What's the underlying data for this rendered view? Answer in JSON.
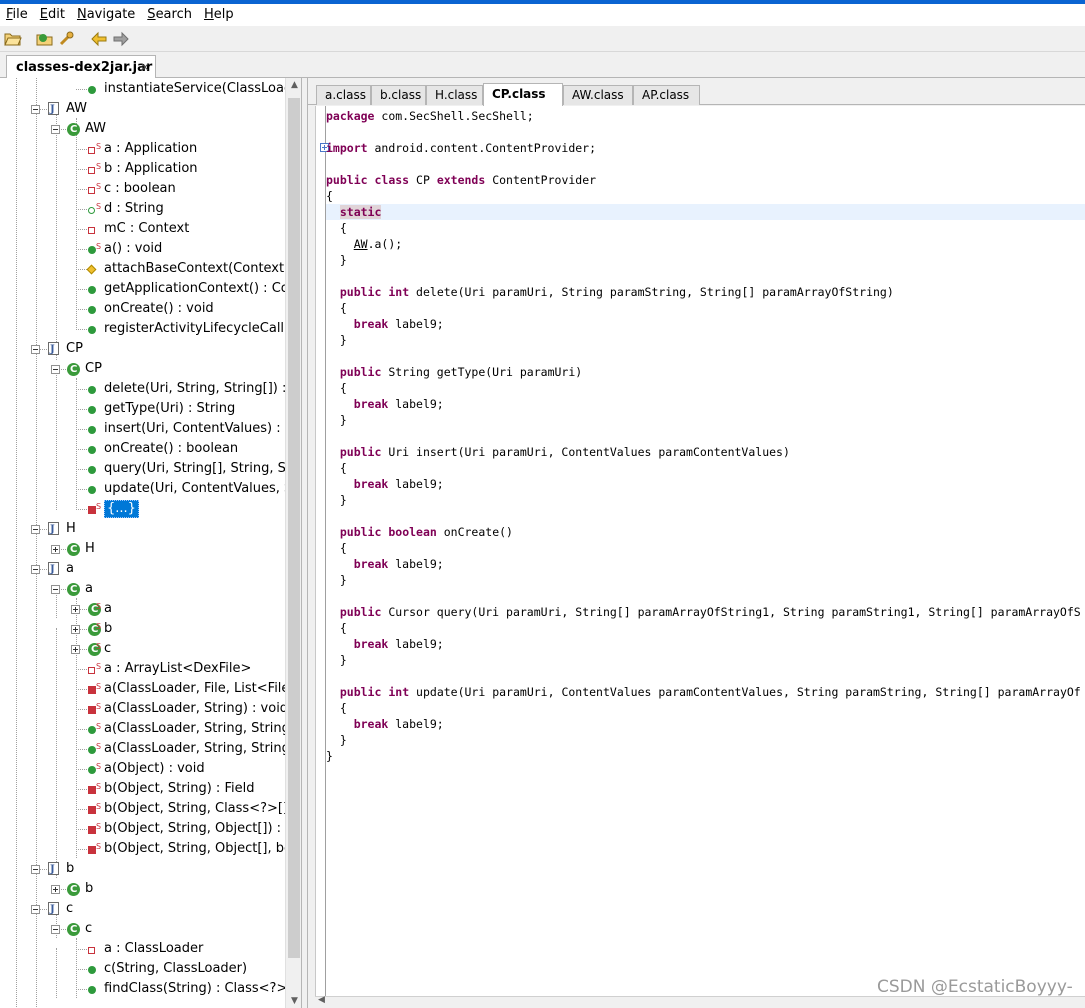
{
  "menu": [
    {
      "label": "File",
      "mnemonic": "F",
      "rest": "ile"
    },
    {
      "label": "Edit",
      "mnemonic": "E",
      "rest": "dit"
    },
    {
      "label": "Navigate",
      "mnemonic": "N",
      "rest": "avigate"
    },
    {
      "label": "Search",
      "mnemonic": "S",
      "rest": "earch"
    },
    {
      "label": "Help",
      "mnemonic": "H",
      "rest": "elp"
    }
  ],
  "toolbar": {
    "icons": [
      "open-file-icon",
      "open-type-icon",
      "search-icon",
      "back-arrow-icon",
      "forward-arrow-icon"
    ]
  },
  "file_tab": {
    "label": "classes-dex2jar.jar",
    "close": "×"
  },
  "tree": [
    {
      "type": "method",
      "label": "instantiateService(ClassLoader,",
      "level": 3
    },
    {
      "type": "file",
      "label": "AW",
      "level": 1,
      "expander": "minus"
    },
    {
      "type": "class",
      "label": "AW",
      "level": 2,
      "expander": "minus"
    },
    {
      "type": "field-red-s",
      "label": "a : Application",
      "level": 3
    },
    {
      "type": "field-red-s",
      "label": "b : Application",
      "level": 3
    },
    {
      "type": "field-red-s",
      "label": "c : boolean",
      "level": 3
    },
    {
      "type": "field-green-s",
      "label": "d : String",
      "level": 3
    },
    {
      "type": "field-red",
      "label": "mC : Context",
      "level": 3
    },
    {
      "type": "method-s",
      "label": "a() : void",
      "level": 3
    },
    {
      "type": "diamond",
      "label": "attachBaseContext(Context) : vo",
      "level": 3
    },
    {
      "type": "method",
      "label": "getApplicationContext() : Conte",
      "level": 3
    },
    {
      "type": "method",
      "label": "onCreate() : void",
      "level": 3
    },
    {
      "type": "method",
      "label": "registerActivityLifecycleCallback",
      "level": 3
    },
    {
      "type": "file",
      "label": "CP",
      "level": 1,
      "expander": "minus"
    },
    {
      "type": "class",
      "label": "CP",
      "level": 2,
      "expander": "minus"
    },
    {
      "type": "method",
      "label": "delete(Uri, String, String[]) : int",
      "level": 3
    },
    {
      "type": "method",
      "label": "getType(Uri) : String",
      "level": 3
    },
    {
      "type": "method",
      "label": "insert(Uri, ContentValues) : Uri",
      "level": 3
    },
    {
      "type": "method",
      "label": "onCreate() : boolean",
      "level": 3
    },
    {
      "type": "method",
      "label": "query(Uri, String[], String, String",
      "level": 3
    },
    {
      "type": "method",
      "label": "update(Uri, ContentValues, Stri",
      "level": 3
    },
    {
      "type": "method-red-s",
      "label": "{...}",
      "level": 3,
      "selected": true
    },
    {
      "type": "file",
      "label": "H",
      "level": 1,
      "expander": "minus"
    },
    {
      "type": "class",
      "label": "H",
      "level": 2,
      "expander": "plus"
    },
    {
      "type": "file",
      "label": "a",
      "level": 1,
      "expander": "minus"
    },
    {
      "type": "class",
      "label": "a",
      "level": 2,
      "expander": "minus"
    },
    {
      "type": "class-s",
      "label": "a",
      "level": 3,
      "expander": "plus"
    },
    {
      "type": "class-s",
      "label": "b",
      "level": 3,
      "expander": "plus"
    },
    {
      "type": "class-s",
      "label": "c",
      "level": 3,
      "expander": "plus"
    },
    {
      "type": "field-red-s",
      "label": "a : ArrayList<DexFile>",
      "level": 3
    },
    {
      "type": "method-red-s",
      "label": "a(ClassLoader, File, List<File>,",
      "level": 3
    },
    {
      "type": "method-red-s",
      "label": "a(ClassLoader, String) : void",
      "level": 3
    },
    {
      "type": "method-s",
      "label": "a(ClassLoader, String, String) :",
      "level": 3
    },
    {
      "type": "method-s",
      "label": "a(ClassLoader, String, String, b",
      "level": 3
    },
    {
      "type": "method-s",
      "label": "a(Object) : void",
      "level": 3
    },
    {
      "type": "method-red-s",
      "label": "b(Object, String) : Field",
      "level": 3
    },
    {
      "type": "method-red-s",
      "label": "b(Object, String, Class<?>[]) : M",
      "level": 3
    },
    {
      "type": "method-red-s",
      "label": "b(Object, String, Object[]) : voi",
      "level": 3
    },
    {
      "type": "method-red-s",
      "label": "b(Object, String, Object[], bool",
      "level": 3
    },
    {
      "type": "file",
      "label": "b",
      "level": 1,
      "expander": "minus"
    },
    {
      "type": "class",
      "label": "b",
      "level": 2,
      "expander": "plus"
    },
    {
      "type": "file",
      "label": "c",
      "level": 1,
      "expander": "minus"
    },
    {
      "type": "class",
      "label": "c",
      "level": 2,
      "expander": "minus"
    },
    {
      "type": "field-red",
      "label": "a : ClassLoader",
      "level": 3
    },
    {
      "type": "method",
      "label": "c(String, ClassLoader)",
      "level": 3
    },
    {
      "type": "method",
      "label": "findClass(String) : Class<?>",
      "level": 3
    }
  ],
  "code_tabs": [
    {
      "label": "a.class"
    },
    {
      "label": "b.class"
    },
    {
      "label": "H.class"
    },
    {
      "label": "CP.class",
      "active": true
    },
    {
      "label": "AW.class"
    },
    {
      "label": "AP.class"
    }
  ],
  "code_lines": [
    [
      {
        "t": "package",
        "c": "kw"
      },
      {
        "t": " com.SecShell.SecShell;"
      }
    ],
    [],
    [
      {
        "t": "import",
        "c": "kw"
      },
      {
        "t": " android.content.ContentProvider;"
      }
    ],
    [],
    [
      {
        "t": "public",
        "c": "kw"
      },
      {
        "t": " "
      },
      {
        "t": "class",
        "c": "kw"
      },
      {
        "t": " CP "
      },
      {
        "t": "extends",
        "c": "kw"
      },
      {
        "t": " ContentProvider"
      }
    ],
    [
      {
        "t": "{"
      }
    ],
    [
      {
        "t": "  "
      },
      {
        "t": "static",
        "c": "kw-hl"
      }
    ],
    [
      {
        "t": "  {"
      }
    ],
    [
      {
        "t": "    "
      },
      {
        "t": "AW",
        "c": "u"
      },
      {
        "t": ".a();"
      }
    ],
    [
      {
        "t": "  }"
      }
    ],
    [],
    [
      {
        "t": "  "
      },
      {
        "t": "public",
        "c": "kw"
      },
      {
        "t": " "
      },
      {
        "t": "int",
        "c": "kw"
      },
      {
        "t": " delete(Uri paramUri, String paramString, String[] paramArrayOfString)"
      }
    ],
    [
      {
        "t": "  {"
      }
    ],
    [
      {
        "t": "    "
      },
      {
        "t": "break",
        "c": "kw"
      },
      {
        "t": " label9;"
      }
    ],
    [
      {
        "t": "  }"
      }
    ],
    [],
    [
      {
        "t": "  "
      },
      {
        "t": "public",
        "c": "kw"
      },
      {
        "t": " String getType(Uri paramUri)"
      }
    ],
    [
      {
        "t": "  {"
      }
    ],
    [
      {
        "t": "    "
      },
      {
        "t": "break",
        "c": "kw"
      },
      {
        "t": " label9;"
      }
    ],
    [
      {
        "t": "  }"
      }
    ],
    [],
    [
      {
        "t": "  "
      },
      {
        "t": "public",
        "c": "kw"
      },
      {
        "t": " Uri insert(Uri paramUri, ContentValues paramContentValues)"
      }
    ],
    [
      {
        "t": "  {"
      }
    ],
    [
      {
        "t": "    "
      },
      {
        "t": "break",
        "c": "kw"
      },
      {
        "t": " label9;"
      }
    ],
    [
      {
        "t": "  }"
      }
    ],
    [],
    [
      {
        "t": "  "
      },
      {
        "t": "public",
        "c": "kw"
      },
      {
        "t": " "
      },
      {
        "t": "boolean",
        "c": "kw"
      },
      {
        "t": " onCreate()"
      }
    ],
    [
      {
        "t": "  {"
      }
    ],
    [
      {
        "t": "    "
      },
      {
        "t": "break",
        "c": "kw"
      },
      {
        "t": " label9;"
      }
    ],
    [
      {
        "t": "  }"
      }
    ],
    [],
    [
      {
        "t": "  "
      },
      {
        "t": "public",
        "c": "kw"
      },
      {
        "t": " Cursor query(Uri paramUri, String[] paramArrayOfString1, String paramString1, String[] paramArrayOfS"
      }
    ],
    [
      {
        "t": "  {"
      }
    ],
    [
      {
        "t": "    "
      },
      {
        "t": "break",
        "c": "kw"
      },
      {
        "t": " label9;"
      }
    ],
    [
      {
        "t": "  }"
      }
    ],
    [],
    [
      {
        "t": "  "
      },
      {
        "t": "public",
        "c": "kw"
      },
      {
        "t": " "
      },
      {
        "t": "int",
        "c": "kw"
      },
      {
        "t": " update(Uri paramUri, ContentValues paramContentValues, String paramString, String[] paramArrayOf"
      }
    ],
    [
      {
        "t": "  {"
      }
    ],
    [
      {
        "t": "    "
      },
      {
        "t": "break",
        "c": "kw"
      },
      {
        "t": " label9;"
      }
    ],
    [
      {
        "t": "  }"
      }
    ],
    [
      {
        "t": "}"
      }
    ]
  ],
  "watermark": "CSDN @EcstaticBoyyy-"
}
